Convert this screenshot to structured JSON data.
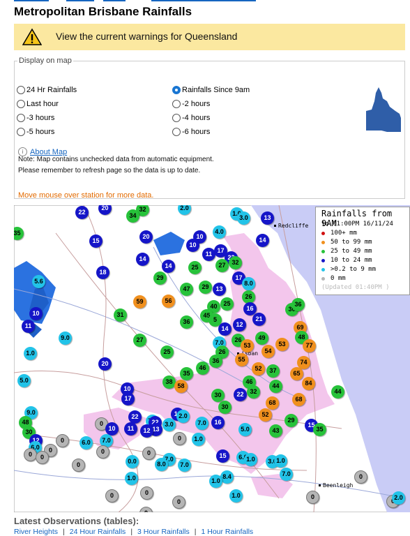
{
  "page_title": "Metropolitan Brisbane Rainfalls",
  "warning": {
    "text": "View the current warnings for Queensland"
  },
  "display": {
    "legend": "Display on map",
    "options": [
      {
        "label": "24 Hr Rainfalls",
        "selected": false
      },
      {
        "label": "Rainfalls Since 9am",
        "selected": true
      },
      {
        "label": "Last hour",
        "selected": false
      },
      {
        "label": "-2 hours",
        "selected": false
      },
      {
        "label": "-3 hours",
        "selected": false
      },
      {
        "label": "-4 hours",
        "selected": false
      },
      {
        "label": "-5 hours",
        "selected": false
      },
      {
        "label": "-6 hours",
        "selected": false
      }
    ],
    "about_link": "About Map",
    "note1": "Note: Map contains unchecked data from automatic equipment.",
    "note2": "Please remember to refresh page so the data is up to date.",
    "mouse_hint": "Move mouse over station for more data."
  },
  "map": {
    "legend": {
      "title": "Rainfalls from 9AM",
      "subtitle": "to 01:00PM 16/11/24",
      "classes": [
        {
          "label": "100+ mm",
          "color": "#d01010"
        },
        {
          "label": "50  to 99 mm",
          "color": "#f0901e"
        },
        {
          "label": "25  to 49 mm",
          "color": "#27c23a"
        },
        {
          "label": "10  to 24 mm",
          "color": "#1515c8"
        },
        {
          "label": ">0.2 to 9 mm",
          "color": "#22c3e8"
        },
        {
          "label": "0 mm",
          "color": "#b5b5b5"
        }
      ],
      "updated": "(Updated 01:40PM  )"
    },
    "places": {
      "redcliffe": "Redcliffe",
      "brisbane": "isban",
      "beenleigh": "Beenleigh"
    },
    "stations": [
      {
        "v": "22",
        "c": "c10"
      },
      {
        "v": "20",
        "c": "c10"
      },
      {
        "v": "32",
        "c": "c25"
      },
      {
        "v": "34",
        "c": "c25"
      },
      {
        "v": "2.0",
        "c": "c02"
      },
      {
        "v": "1.0",
        "c": "c02"
      },
      {
        "v": "3.0",
        "c": "c02"
      },
      {
        "v": "13",
        "c": "c10"
      },
      {
        "v": "35",
        "c": "c25"
      },
      {
        "v": "15",
        "c": "c10"
      },
      {
        "v": "20",
        "c": "c10"
      },
      {
        "v": "10",
        "c": "c10"
      },
      {
        "v": "4.0",
        "c": "c02"
      },
      {
        "v": "10",
        "c": "c10"
      },
      {
        "v": "11",
        "c": "c10"
      },
      {
        "v": "17",
        "c": "c10"
      },
      {
        "v": "22",
        "c": "c10"
      },
      {
        "v": "14",
        "c": "c10"
      },
      {
        "v": "14",
        "c": "c10"
      },
      {
        "v": "14",
        "c": "c10"
      },
      {
        "v": "25",
        "c": "c25"
      },
      {
        "v": "27",
        "c": "c25"
      },
      {
        "v": "32",
        "c": "c25"
      },
      {
        "v": "18",
        "c": "c10"
      },
      {
        "v": "5.6",
        "c": "c02"
      },
      {
        "v": "29",
        "c": "c25"
      },
      {
        "v": "17",
        "c": "c10"
      },
      {
        "v": "8.0",
        "c": "c02"
      },
      {
        "v": "47",
        "c": "c25"
      },
      {
        "v": "29",
        "c": "c25"
      },
      {
        "v": "13",
        "c": "c10"
      },
      {
        "v": "59",
        "c": "c50"
      },
      {
        "v": "56",
        "c": "c50"
      },
      {
        "v": "26",
        "c": "c25"
      },
      {
        "v": "40",
        "c": "c25"
      },
      {
        "v": "25",
        "c": "c25"
      },
      {
        "v": "16",
        "c": "c10"
      },
      {
        "v": "30",
        "c": "c25"
      },
      {
        "v": "36",
        "c": "c25"
      },
      {
        "v": "10",
        "c": "c10"
      },
      {
        "v": "31",
        "c": "c25"
      },
      {
        "v": "45",
        "c": "c25"
      },
      {
        "v": "5",
        "c": "c25"
      },
      {
        "v": "21",
        "c": "c10"
      },
      {
        "v": "69",
        "c": "c50"
      },
      {
        "v": "11",
        "c": "c10"
      },
      {
        "v": "36",
        "c": "c25"
      },
      {
        "v": "14",
        "c": "c10"
      },
      {
        "v": "12",
        "c": "c10"
      },
      {
        "v": "49",
        "c": "c25"
      },
      {
        "v": "9.0",
        "c": "c02"
      },
      {
        "v": "27",
        "c": "c25"
      },
      {
        "v": "7.0",
        "c": "c02"
      },
      {
        "v": "26",
        "c": "c25"
      },
      {
        "v": "53",
        "c": "c50"
      },
      {
        "v": "53",
        "c": "c50"
      },
      {
        "v": "48",
        "c": "c25"
      },
      {
        "v": "1.0",
        "c": "c02"
      },
      {
        "v": "25",
        "c": "c25"
      },
      {
        "v": "26",
        "c": "c25"
      },
      {
        "v": "54",
        "c": "c50"
      },
      {
        "v": "77",
        "c": "c50"
      },
      {
        "v": "20",
        "c": "c10"
      },
      {
        "v": "36",
        "c": "c25"
      },
      {
        "v": "55",
        "c": "c50"
      },
      {
        "v": "74",
        "c": "c50"
      },
      {
        "v": "46",
        "c": "c25"
      },
      {
        "v": "35",
        "c": "c25"
      },
      {
        "v": "52",
        "c": "c50"
      },
      {
        "v": "37",
        "c": "c25"
      },
      {
        "v": "65",
        "c": "c50"
      },
      {
        "v": "5.0",
        "c": "c02"
      },
      {
        "v": "38",
        "c": "c25"
      },
      {
        "v": "58",
        "c": "c50"
      },
      {
        "v": "46",
        "c": "c25"
      },
      {
        "v": "44",
        "c": "c25"
      },
      {
        "v": "84",
        "c": "c50"
      },
      {
        "v": "10",
        "c": "c10"
      },
      {
        "v": "30",
        "c": "c25"
      },
      {
        "v": "22",
        "c": "c10"
      },
      {
        "v": "32",
        "c": "c25"
      },
      {
        "v": "68",
        "c": "c50"
      },
      {
        "v": "68",
        "c": "c50"
      },
      {
        "v": "44",
        "c": "c25"
      },
      {
        "v": "17",
        "c": "c10"
      },
      {
        "v": "30",
        "c": "c25"
      },
      {
        "v": "9.0",
        "c": "c02"
      },
      {
        "v": "22",
        "c": "c10"
      },
      {
        "v": "11",
        "c": "c10"
      },
      {
        "v": "16",
        "c": "c10"
      },
      {
        "v": "52",
        "c": "c50"
      },
      {
        "v": "29",
        "c": "c25"
      },
      {
        "v": "2.0",
        "c": "c02"
      },
      {
        "v": "7.0",
        "c": "c02"
      },
      {
        "v": "22",
        "c": "c10"
      },
      {
        "v": "3.0",
        "c": "c02"
      },
      {
        "v": "7.0",
        "c": "c02"
      },
      {
        "v": "15",
        "c": "c10"
      },
      {
        "v": "35",
        "c": "c25"
      },
      {
        "v": "48",
        "c": "c25"
      },
      {
        "v": "0",
        "c": "c0"
      },
      {
        "v": "10",
        "c": "c10"
      },
      {
        "v": "11",
        "c": "c10"
      },
      {
        "v": "5.0",
        "c": "c02"
      },
      {
        "v": "43",
        "c": "c25"
      },
      {
        "v": "30",
        "c": "c25"
      },
      {
        "v": "0",
        "c": "c0"
      },
      {
        "v": "6.0",
        "c": "c02"
      },
      {
        "v": "13",
        "c": "c10"
      },
      {
        "v": "7.0",
        "c": "c02"
      },
      {
        "v": "12",
        "c": "c10"
      },
      {
        "v": "12",
        "c": "c10"
      },
      {
        "v": "0",
        "c": "c0"
      },
      {
        "v": "1.0",
        "c": "c02"
      },
      {
        "v": "6.0",
        "c": "c02"
      },
      {
        "v": "0",
        "c": "c0"
      },
      {
        "v": "0",
        "c": "c0"
      },
      {
        "v": "0",
        "c": "c0"
      },
      {
        "v": "0",
        "c": "c0"
      },
      {
        "v": "0",
        "c": "c0"
      },
      {
        "v": "0.0",
        "c": "c02"
      },
      {
        "v": "7.0",
        "c": "c02"
      },
      {
        "v": "15",
        "c": "c10"
      },
      {
        "v": "8.0",
        "c": "c02"
      },
      {
        "v": "7.0",
        "c": "c02"
      },
      {
        "v": "6.0",
        "c": "c02"
      },
      {
        "v": "1.0",
        "c": "c02"
      },
      {
        "v": "3.0",
        "c": "c02"
      },
      {
        "v": "1.0",
        "c": "c02"
      },
      {
        "v": "0",
        "c": "c0"
      },
      {
        "v": "1.0",
        "c": "c02"
      },
      {
        "v": "8.4",
        "c": "c02"
      },
      {
        "v": "1.0",
        "c": "c02"
      },
      {
        "v": "7.0",
        "c": "c02"
      },
      {
        "v": "0",
        "c": "c0"
      },
      {
        "v": "0",
        "c": "c0"
      },
      {
        "v": "0",
        "c": "c0"
      },
      {
        "v": "0",
        "c": "c0"
      },
      {
        "v": "1.0",
        "c": "c02"
      },
      {
        "v": "0",
        "c": "c0"
      },
      {
        "v": "0",
        "c": "c0"
      },
      {
        "v": "2.0",
        "c": "c02"
      },
      {
        "v": "0",
        "c": "c0"
      }
    ]
  },
  "latest": {
    "title": "Latest Observations (tables):",
    "links": [
      "River Heights",
      "24 Hour Rainfalls",
      "3 Hour Rainfalls",
      "1 Hour Rainfalls"
    ]
  }
}
